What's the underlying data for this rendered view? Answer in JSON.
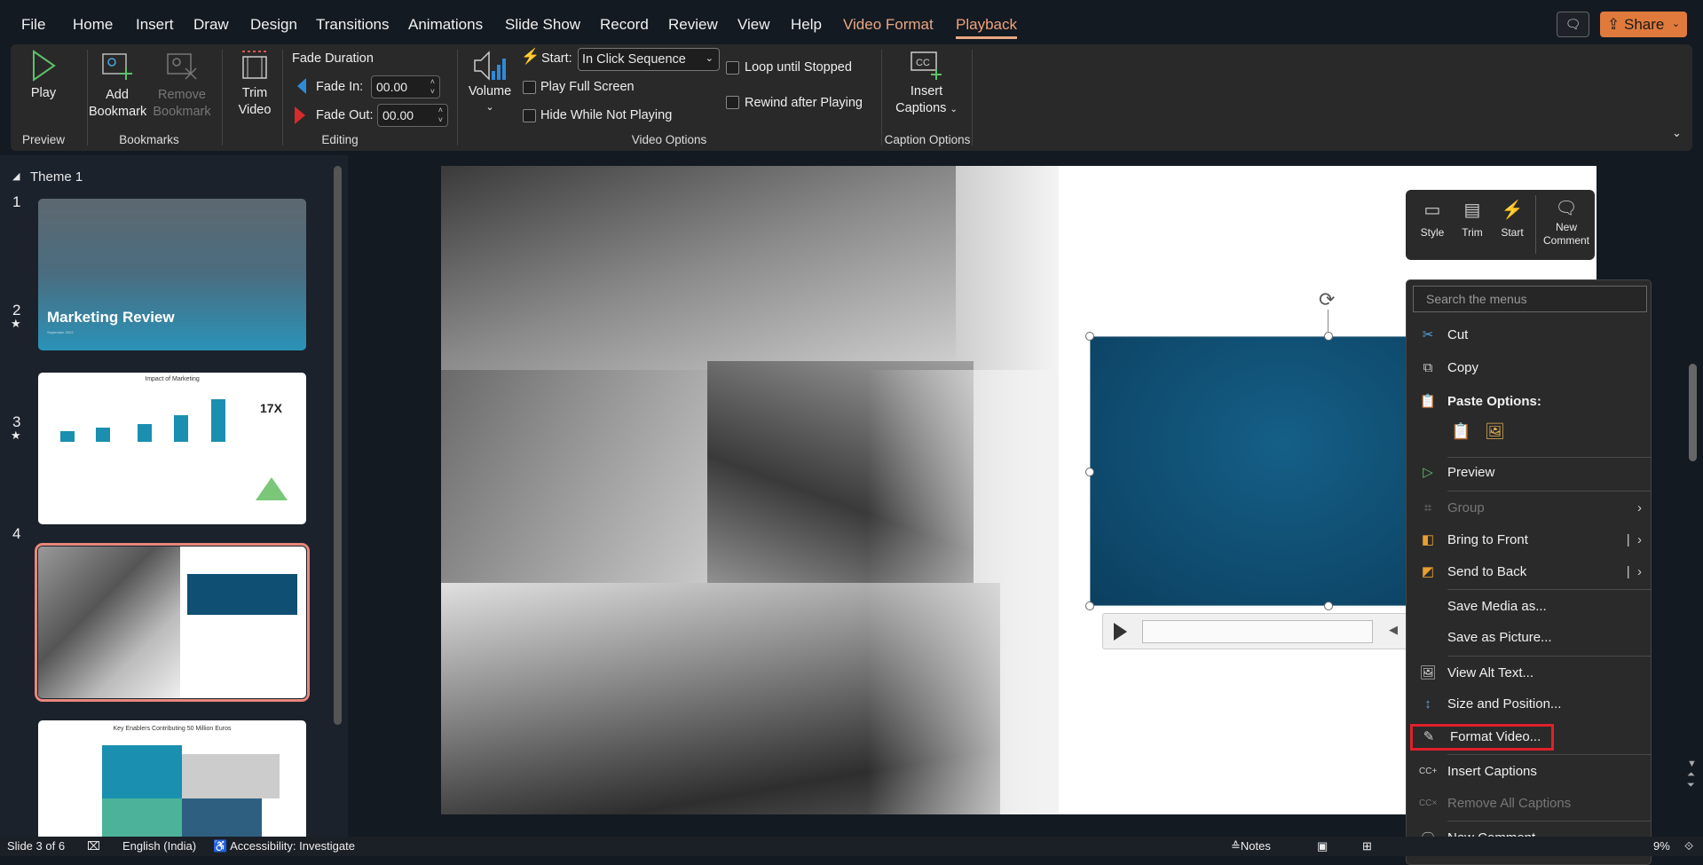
{
  "tabs": [
    {
      "label": "File"
    },
    {
      "label": "Home"
    },
    {
      "label": "Insert"
    },
    {
      "label": "Draw"
    },
    {
      "label": "Design"
    },
    {
      "label": "Transitions"
    },
    {
      "label": "Animations"
    },
    {
      "label": "Slide Show"
    },
    {
      "label": "Record"
    },
    {
      "label": "Review"
    },
    {
      "label": "View"
    },
    {
      "label": "Help"
    },
    {
      "label": "Video Format"
    },
    {
      "label": "Playback"
    }
  ],
  "active_tab": "Playback",
  "share_label": "Share",
  "ribbon": {
    "play": "Play",
    "preview_group": "Preview",
    "add_bookmark_1": "Add",
    "add_bookmark_2": "Bookmark",
    "remove_bookmark_1": "Remove",
    "remove_bookmark_2": "Bookmark",
    "bookmarks_group": "Bookmarks",
    "trim_1": "Trim",
    "trim_2": "Video",
    "fade_duration": "Fade Duration",
    "fade_in_label": "Fade In:",
    "fade_in_value": "00.00",
    "fade_out_label": "Fade Out:",
    "fade_out_value": "00.00",
    "editing_group": "Editing",
    "volume": "Volume",
    "start_label": "Start:",
    "start_value": "In Click Sequence",
    "play_full_screen": "Play Full Screen",
    "hide_while_not_playing": "Hide While Not Playing",
    "loop_until_stopped": "Loop until Stopped",
    "rewind_after_playing": "Rewind after Playing",
    "video_options_group": "Video Options",
    "insert_captions_1": "Insert",
    "insert_captions_2": "Captions",
    "caption_options_group": "Caption Options"
  },
  "checkboxes": {
    "play_full_screen": false,
    "hide_while_not_playing": false,
    "loop_until_stopped": false,
    "rewind_after_playing": false
  },
  "slides_panel": {
    "section": "Theme 1",
    "slides": [
      {
        "number": "1",
        "title": "Marketing Review",
        "subtitle": "September 2022"
      },
      {
        "number": "2",
        "title": "Impact of Marketing",
        "big": "17X",
        "starred": true
      },
      {
        "number": "3",
        "starred": true,
        "selected": true
      },
      {
        "number": "4",
        "title": "Key Enablers Contributing 50 Million Euros"
      }
    ]
  },
  "mini_toolbar": {
    "style": "Style",
    "trim": "Trim",
    "start": "Start",
    "new_comment_1": "New",
    "new_comment_2": "Comment"
  },
  "context_menu": {
    "search_placeholder": "Search the menus",
    "cut": "Cut",
    "copy": "Copy",
    "paste_options": "Paste Options:",
    "preview": "Preview",
    "group": "Group",
    "bring_to_front": "Bring to Front",
    "send_to_back": "Send to Back",
    "save_media_as": "Save Media as...",
    "save_as_picture": "Save as Picture...",
    "view_alt_text": "View Alt Text...",
    "size_and_position": "Size and Position...",
    "format_video": "Format Video...",
    "insert_captions": "Insert Captions",
    "remove_all_captions": "Remove All Captions",
    "new_comment": "New Comment"
  },
  "status": {
    "slide": "Slide 3 of 6",
    "language": "English (India)",
    "accessibility": "Accessibility: Investigate",
    "notes": "Notes",
    "zoom": "9%"
  },
  "colors": {
    "accent": "#e8a883",
    "share": "#e07a3c",
    "highlight": "#e0202a",
    "video": "#0e4f73"
  }
}
